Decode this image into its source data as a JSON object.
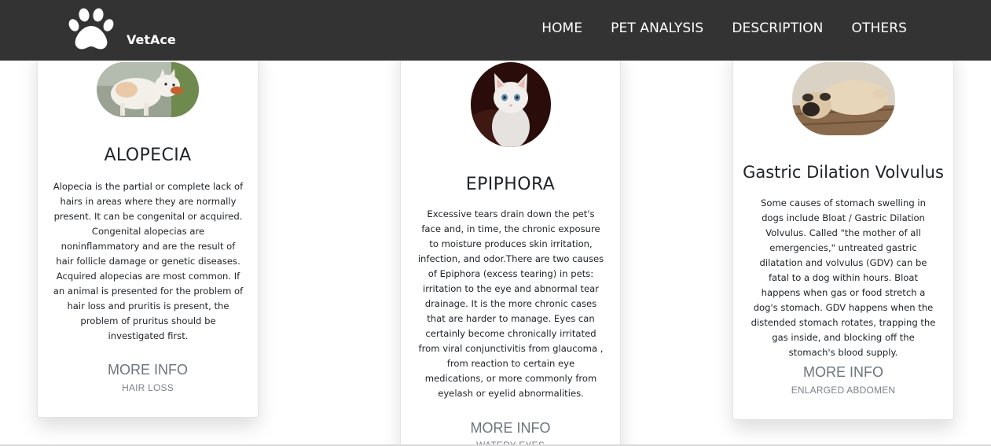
{
  "brand": {
    "name": "VetAce",
    "logo_icon": "paw-icon"
  },
  "nav": {
    "items": [
      {
        "label": "HOME"
      },
      {
        "label": "PET ANALYSIS"
      },
      {
        "label": "DESCRIPTION"
      },
      {
        "label": "OTHERS"
      }
    ]
  },
  "cards": [
    {
      "title": "ALOPECIA",
      "image": "dog-photo",
      "text": "Alopecia is the partial or complete lack of hairs in areas where they are normally present. It can be congenital or acquired. Congenital alopecias are noninflammatory and are the result of hair follicle damage or genetic diseases. Acquired alopecias are most common. If an animal is presented for the problem of hair loss and pruritis is present, the problem of pruritus should be investigated first.",
      "more_info": "MORE INFO",
      "subtitle": "HAIR LOSS"
    },
    {
      "title": "EPIPHORA",
      "image": "kitten-photo",
      "text": "Excessive tears drain down the pet's face and, in time, the chronic exposure to moisture produces skin irritation, infection, and odor.There are two causes of Epiphora (excess tearing) in pets: irritation to the eye and abnormal tear drainage. It is the more chronic cases that are harder to manage. Eyes can certainly become chronically irritated from viral conjunctivitis from glaucoma , from reaction to certain eye medications, or more commonly from eyelash or eyelid abnormalities.",
      "more_info": "MORE INFO",
      "subtitle": "WATERY EYES"
    },
    {
      "title": "Gastric Dilation Volvulus",
      "image": "pug-photo",
      "text": "Some causes of stomach swelling in dogs include Bloat / Gastric Dilation Volvulus. Called \"the mother of all emergencies,\" untreated gastric dilatation and volvulus (GDV) can be fatal to a dog within hours. Bloat happens when gas or food stretch a dog's stomach. GDV happens when the distended stomach rotates, trapping the gas inside, and blocking off the stomach's blood supply.",
      "more_info": "MORE INFO",
      "subtitle": "ENLARGED ABDOMEN"
    }
  ],
  "colors": {
    "navbar": "#333333",
    "nav_text": "#ffffff",
    "muted_text": "#6c757d",
    "card_border": "#e4e4e4"
  }
}
